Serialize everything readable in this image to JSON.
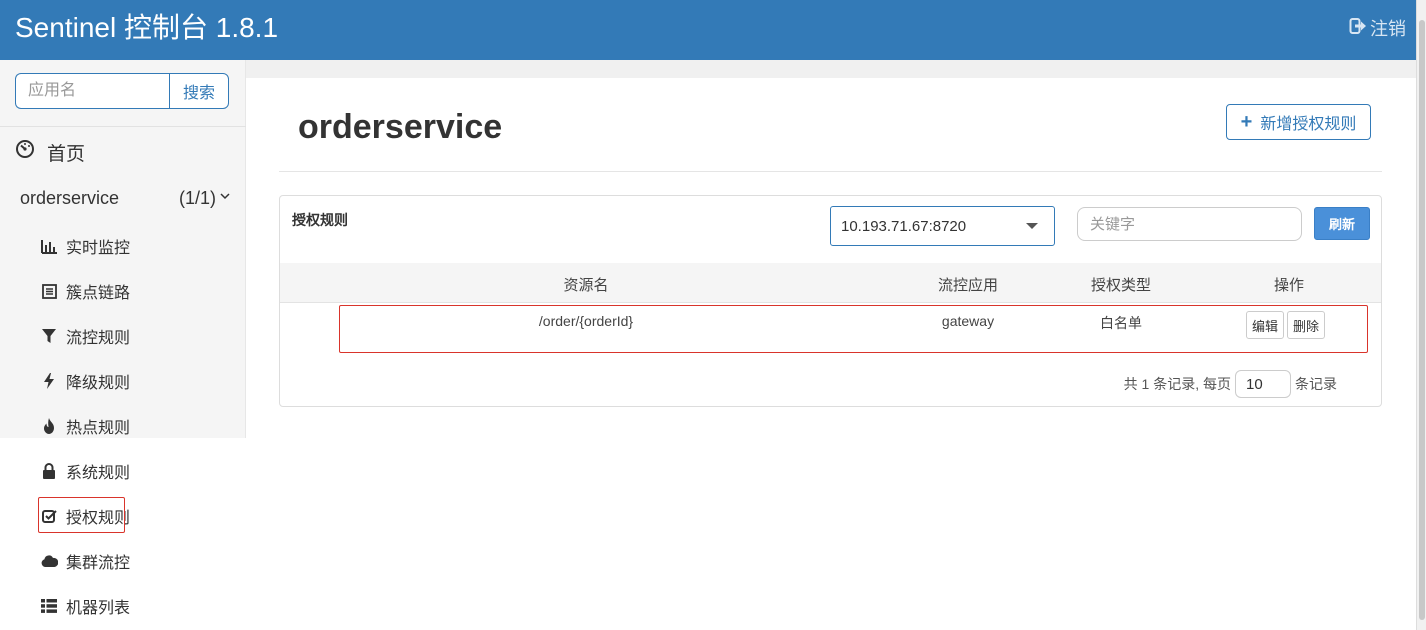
{
  "header": {
    "brand": "Sentinel 控制台 1.8.1",
    "logout_label": "注销"
  },
  "sidebar": {
    "search_placeholder": "应用名",
    "search_button": "搜索",
    "home_label": "首页",
    "app": {
      "name": "orderservice",
      "count": "(1/1)"
    },
    "menu": [
      {
        "label": "实时监控",
        "icon": "bar-chart-icon"
      },
      {
        "label": "簇点链路",
        "icon": "list-alt-icon"
      },
      {
        "label": "流控规则",
        "icon": "filter-icon"
      },
      {
        "label": "降级规则",
        "icon": "flash-icon"
      },
      {
        "label": "热点规则",
        "icon": "fire-icon"
      },
      {
        "label": "系统规则",
        "icon": "lock-icon"
      },
      {
        "label": "授权规则",
        "icon": "check-icon"
      },
      {
        "label": "集群流控",
        "icon": "cloud-icon"
      },
      {
        "label": "机器列表",
        "icon": "th-list-icon"
      }
    ]
  },
  "main": {
    "title": "orderservice",
    "add_button": "新增授权规则",
    "panel": {
      "title": "授权规则",
      "machine_selected": "10.193.71.67:8720",
      "keyword_placeholder": "关键字",
      "refresh_button": "刷新",
      "columns": [
        "资源名",
        "流控应用",
        "授权类型",
        "操作"
      ],
      "rows": [
        {
          "resource": "/order/{orderId}",
          "limit_app": "gateway",
          "strategy": "白名单",
          "edit": "编辑",
          "delete": "删除"
        }
      ],
      "pager": {
        "total_text": "共 1 条记录, 每页",
        "page_size": "10",
        "suffix": "条记录"
      }
    }
  },
  "colors": {
    "header_bg": "#337ab7",
    "accent": "#337ab7",
    "highlight_border": "#d9342b",
    "refresh_bg": "#4a90d9"
  }
}
